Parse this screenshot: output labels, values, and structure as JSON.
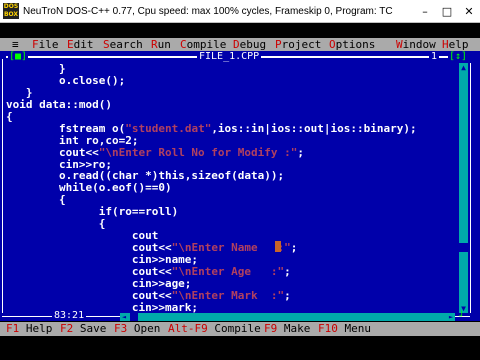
{
  "window": {
    "icon_text": "DOS BOX",
    "title": "NeuTroN DOS-C++ 0.77, Cpu speed: max 100% cycles, Frameskip 0, Program:      TC",
    "minimize": "–",
    "maximize": "□",
    "close": "✕"
  },
  "menu": {
    "system": "≡",
    "items": [
      {
        "hot": "F",
        "rest": "ile"
      },
      {
        "hot": "E",
        "rest": "dit"
      },
      {
        "hot": "S",
        "rest": "earch"
      },
      {
        "hot": "R",
        "rest": "un"
      },
      {
        "hot": "C",
        "rest": "ompile"
      },
      {
        "hot": "D",
        "rest": "ebug"
      },
      {
        "hot": "P",
        "rest": "roject"
      },
      {
        "hot": "O",
        "rest": "ptions"
      },
      {
        "hot": "W",
        "rest": "indow"
      },
      {
        "hot": "H",
        "rest": "elp"
      }
    ]
  },
  "editor": {
    "close_box": "[■]",
    "title": "FILE_1.CPP",
    "window_number": "1",
    "zoom_box": "[↕]",
    "cursor_position": "83:21",
    "code_lines": [
      [
        {
          "t": "        }",
          "c": "plain"
        }
      ],
      [
        {
          "t": "        o.close();",
          "c": "plain"
        }
      ],
      [
        {
          "t": "   }",
          "c": "plain"
        }
      ],
      [
        {
          "t": "void data::mod()",
          "c": "plain"
        }
      ],
      [
        {
          "t": "{",
          "c": "plain"
        }
      ],
      [
        {
          "t": "        fstream o(",
          "c": "plain"
        },
        {
          "t": "\"student.dat\"",
          "c": "str"
        },
        {
          "t": ",ios::in|ios::out|ios::binary);",
          "c": "plain"
        }
      ],
      [
        {
          "t": "        int ro,co=2;",
          "c": "plain"
        }
      ],
      [
        {
          "t": "        cout<<",
          "c": "plain"
        },
        {
          "t": "\"\\nEnter Roll No for Modify :\"",
          "c": "str"
        },
        {
          "t": ";",
          "c": "plain"
        }
      ],
      [
        {
          "t": "        cin>>ro;",
          "c": "plain"
        }
      ],
      [
        {
          "t": "        o.read((char *)this,sizeof(data));",
          "c": "plain"
        }
      ],
      [
        {
          "t": "        while(o.eof()==0)",
          "c": "plain"
        }
      ],
      [
        {
          "t": "        {",
          "c": "plain"
        }
      ],
      [
        {
          "t": "              if(ro==roll)",
          "c": "plain"
        }
      ],
      [
        {
          "t": "              {",
          "c": "plain"
        }
      ],
      [
        {
          "t": "                   cout",
          "c": "plain"
        }
      ],
      [
        {
          "t": "                   cout<<",
          "c": "plain"
        },
        {
          "t": "\"\\nEnter Name   :\"",
          "c": "str"
        },
        {
          "t": ";",
          "c": "plain"
        }
      ],
      [
        {
          "t": "                   cin>>name;",
          "c": "plain"
        }
      ],
      [
        {
          "t": "                   cout<<",
          "c": "plain"
        },
        {
          "t": "\"\\nEnter Age   :\"",
          "c": "str"
        },
        {
          "t": ";",
          "c": "plain"
        }
      ],
      [
        {
          "t": "                   cin>>age;",
          "c": "plain"
        }
      ],
      [
        {
          "t": "                   cout<<",
          "c": "plain"
        },
        {
          "t": "\"\\nEnter Mark  :\"",
          "c": "str"
        },
        {
          "t": ";",
          "c": "plain"
        }
      ],
      [
        {
          "t": "                   cin>>mark;",
          "c": "plain"
        }
      ]
    ]
  },
  "statusbar": [
    {
      "key": "F1",
      "label": " Help"
    },
    {
      "key": "F2",
      "label": " Save"
    },
    {
      "key": "F3",
      "label": " Open"
    },
    {
      "key": "Alt-F9",
      "label": " Compile"
    },
    {
      "key": "F9",
      "label": " Make"
    },
    {
      "key": "F10",
      "label": " Menu"
    }
  ],
  "colors": {
    "editor_bg": "#0000aa",
    "menu_bg": "#aaaaaa",
    "string": "#b04060",
    "hotkey": "#cc0000",
    "scrollbar": "#00aaaa"
  }
}
